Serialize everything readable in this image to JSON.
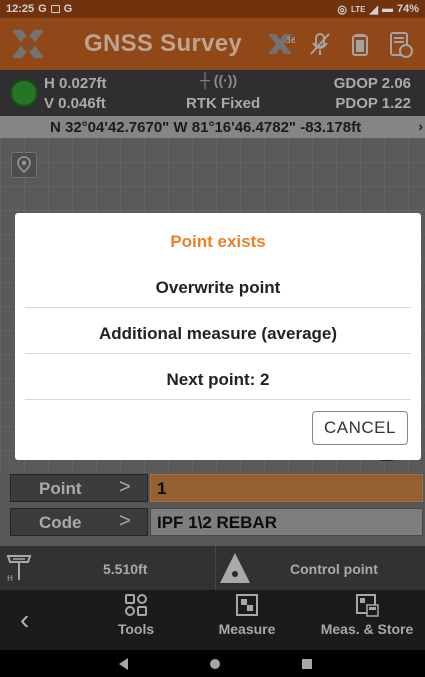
{
  "status_bar": {
    "time": "12:25",
    "carrier": "G",
    "network": "LTE",
    "battery": "74%"
  },
  "app_bar": {
    "title": "GNSS Survey",
    "badge": "365"
  },
  "info": {
    "h_precision": "H 0.027ft",
    "v_precision": "V 0.046ft",
    "solution": "RTK Fixed",
    "gdop": "GDOP 2.06",
    "pdop": "PDOP 1.22"
  },
  "coordinates": "N 32°04'42.7670\" W 81°16'46.4782\" -83.178ft",
  "dialog": {
    "title": "Point exists",
    "options": [
      "Overwrite point",
      "Additional measure (average)",
      "Next point: 2"
    ],
    "cancel_label": "CANCEL"
  },
  "fields": {
    "point_label": "Point",
    "point_value": "1",
    "code_label": "Code",
    "code_value": "IPF 1\\2 REBAR"
  },
  "bottom_info": {
    "antenna_height": "5.510ft",
    "point_type": "Control point"
  },
  "actions": {
    "tools": "Tools",
    "measure": "Measure",
    "meas_store": "Meas. & Store"
  },
  "colors": {
    "app_bar": "#b0581f",
    "dialog_title": "#e8822a",
    "point_field": "#b5753c",
    "fix_dot": "#2f8f2f"
  }
}
